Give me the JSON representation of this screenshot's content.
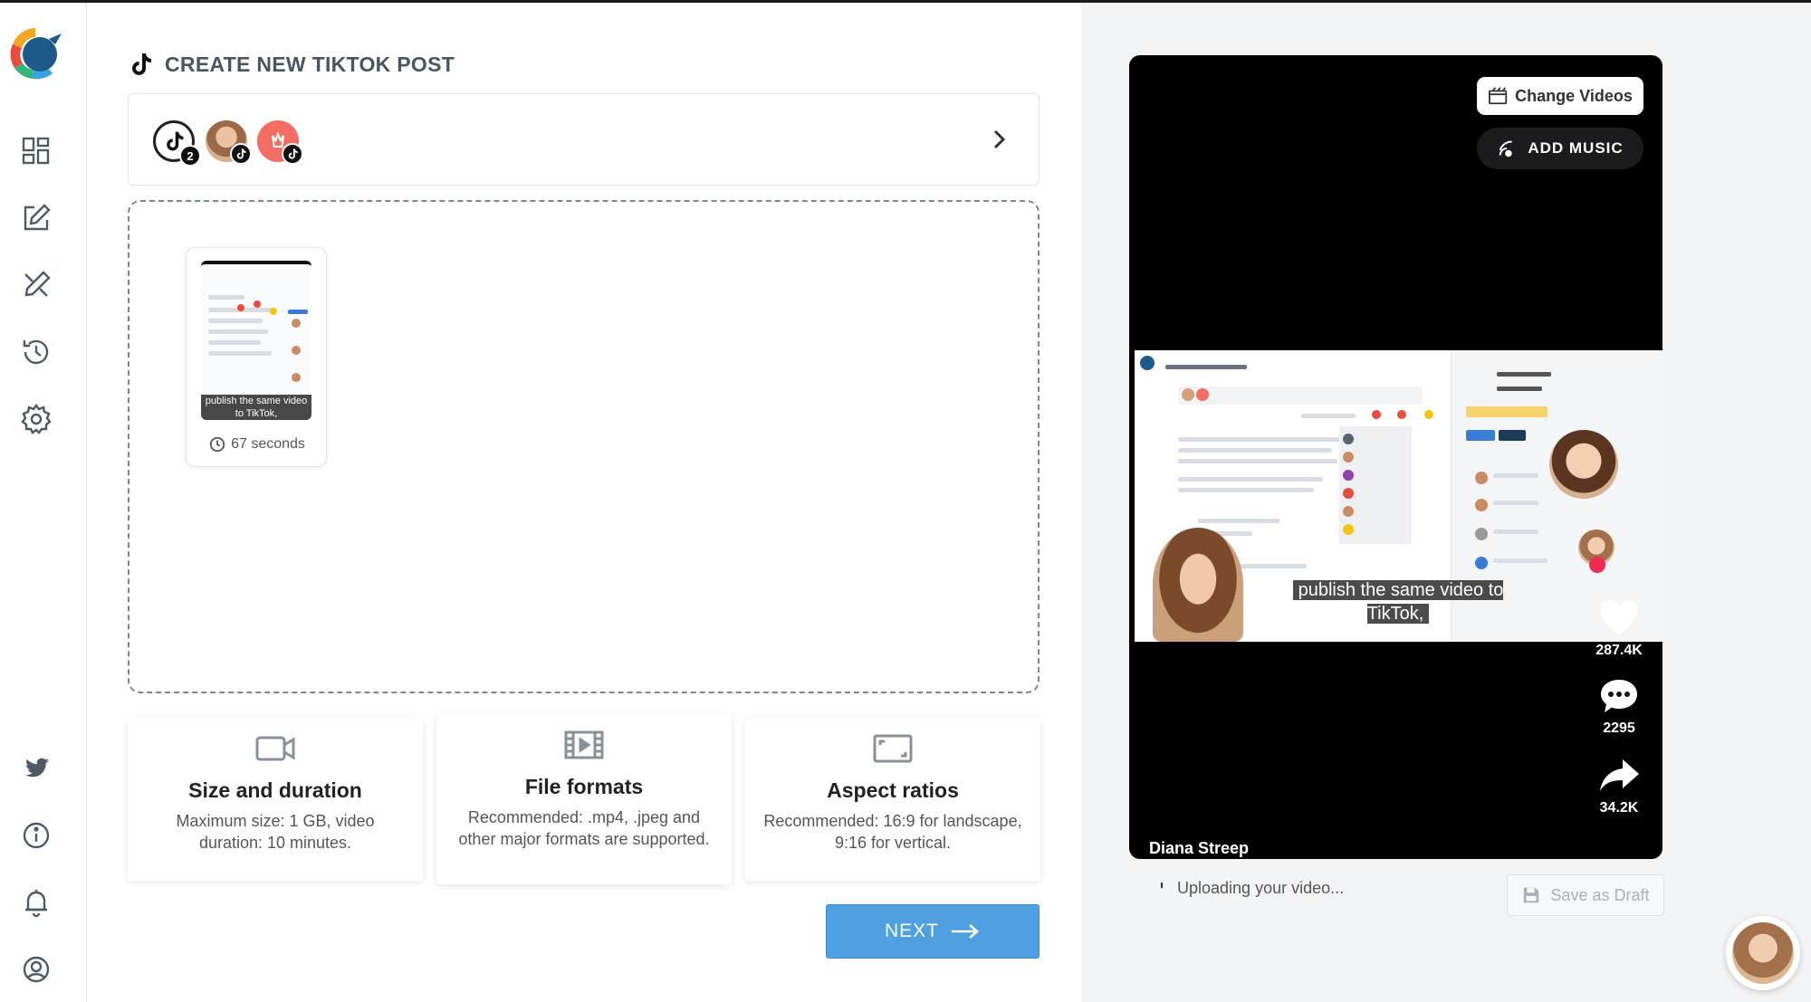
{
  "header": {
    "title": "CREATE NEW TIKTOK POST"
  },
  "accounts": {
    "count_badge": "2"
  },
  "upload": {
    "thumbnail_caption": "publish the same video to TikTok,",
    "duration": "67 seconds"
  },
  "info_cards": [
    {
      "title": "Size and duration",
      "text": "Maximum size: 1 GB, video duration: 10 minutes."
    },
    {
      "title": "File formats",
      "text": "Recommended: .mp4, .jpeg and other major formats are supported."
    },
    {
      "title": "Aspect ratios",
      "text": "Recommended: 16:9 for landscape, 9:16 for vertical."
    }
  ],
  "actions": {
    "next_label": "NEXT"
  },
  "preview": {
    "change_videos": "Change Videos",
    "add_music": "ADD MUSIC",
    "caption": "publish the same video to TikTok,",
    "likes": "287.4K",
    "comments": "2295",
    "shares": "34.2K",
    "creator": "Diana Streep",
    "upload_status": "Uploading your video...",
    "save_draft": "Save as Draft"
  },
  "colors": {
    "accent": "#4ea0e0",
    "logo_blue": "#1d5a8a",
    "tiktok_red": "#f36d63"
  }
}
